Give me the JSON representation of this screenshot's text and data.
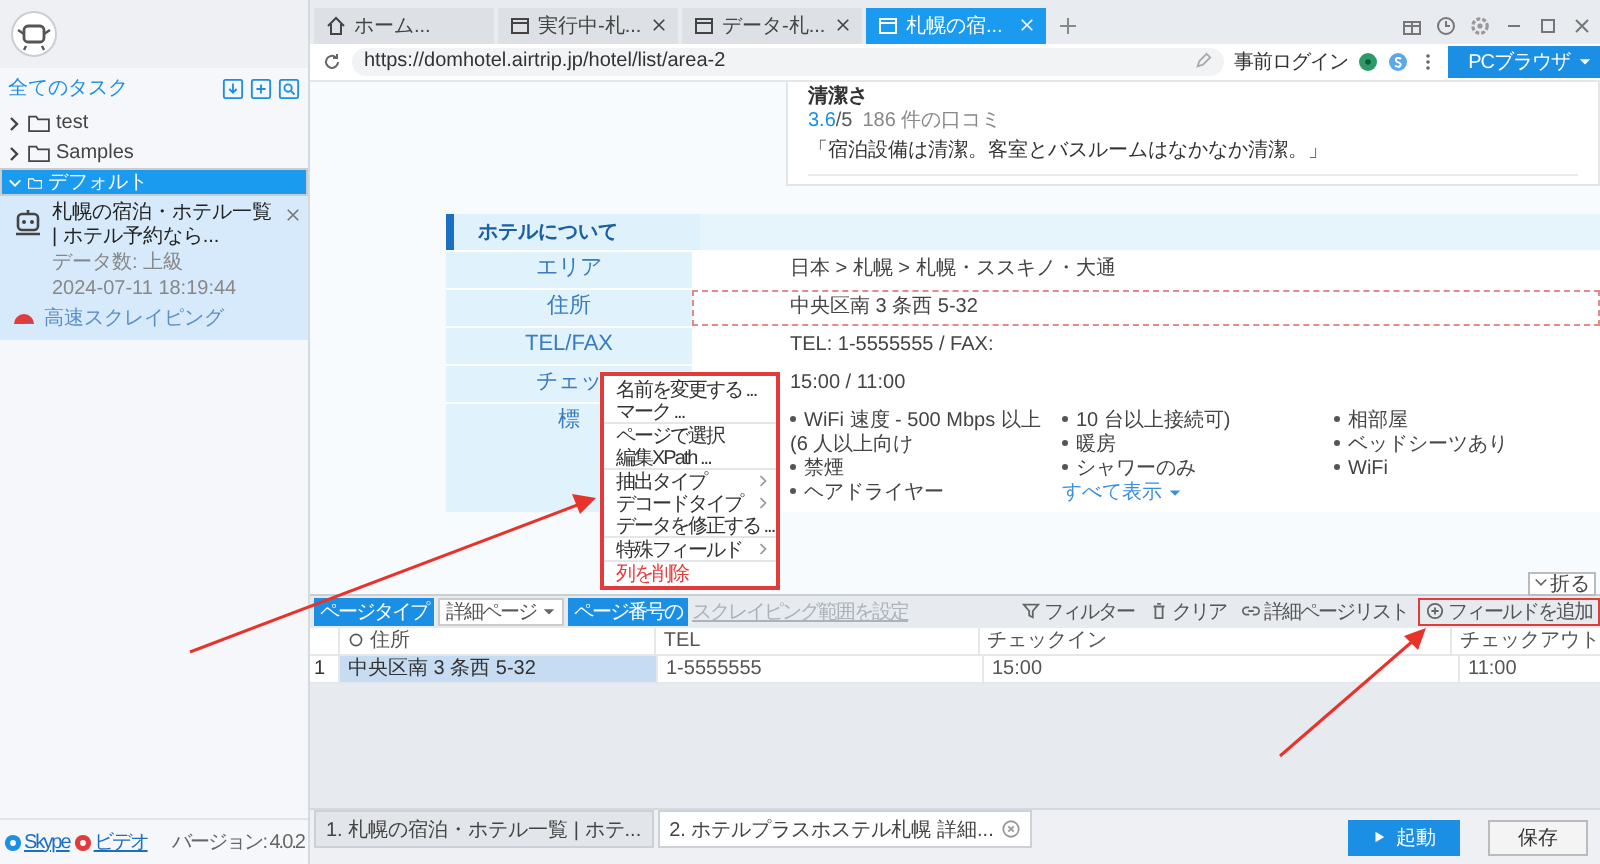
{
  "sidebar": {
    "title": "全てのタスク",
    "tree": [
      {
        "label": "test",
        "expanded": false,
        "selected": false
      },
      {
        "label": "Samples",
        "expanded": false,
        "selected": false
      },
      {
        "label": "デフォルト",
        "expanded": true,
        "selected": true,
        "tasks": [
          {
            "title": "札幌の宿泊・ホテル一覧 | ホテル予約なら...",
            "data_count": "データ数: 上級",
            "time": "2024-07-11 18:19:44",
            "mode": "高速スクレイピング"
          }
        ]
      }
    ],
    "footer": {
      "links": [
        "Skype",
        "ビデオ"
      ],
      "version": "バージョン: 4.0.2"
    }
  },
  "browser": {
    "tabs": [
      {
        "label": "ホーム...",
        "kind": "home",
        "selected": false
      },
      {
        "label": "実行中-札...",
        "kind": "page",
        "selected": false
      },
      {
        "label": "データ-札...",
        "kind": "page",
        "selected": false
      },
      {
        "label": "札幌の宿...",
        "kind": "page",
        "selected": true
      }
    ],
    "url": "https://domhotel.airtrip.jp/hotel/list/area-2",
    "login": "事前ログイン",
    "mode_button": "PCブラウザ"
  },
  "page": {
    "review": {
      "title": "清潔さ",
      "score": "3.6",
      "scale": "/5",
      "count": "186 件の口コミ",
      "quote": "「宿泊設備は清潔。客室とバスルームはなかなか清潔。」"
    },
    "section_title": "ホテルについて",
    "rows": [
      {
        "kind": "text",
        "label": "エリア",
        "value": "日本 > 札幌 > 札幌・ススキノ・大通",
        "highlighted": false
      },
      {
        "kind": "text",
        "label": "住所",
        "value": "中央区南 3 条西 5-32",
        "highlighted": true
      },
      {
        "kind": "text",
        "label": "TEL/FAX",
        "value": "TEL: 1-5555555 / FAX:",
        "highlighted": false
      },
      {
        "kind": "text",
        "label": "チェッ",
        "value": "15:00 / 11:00",
        "highlighted": false
      },
      {
        "kind": "list",
        "label": "標",
        "highlighted": false,
        "more": "すべて表示",
        "columns": [
          [
            "WiFi 速度 - 500 Mbps 以上 (6 人以上向け",
            "禁煙",
            "ヘアドライヤー"
          ],
          [
            "10 台以上接続可)",
            "暖房",
            "シャワーのみ"
          ],
          [
            "相部屋",
            "ベッドシーツあり",
            "WiFi"
          ]
        ]
      }
    ]
  },
  "context_menu": {
    "groups": [
      [
        {
          "label": "名前を変更する ...",
          "submenu": false,
          "danger": false
        },
        {
          "label": "マーク ...",
          "submenu": false,
          "danger": false
        }
      ],
      [
        {
          "label": "ページで選択",
          "submenu": false,
          "danger": false
        },
        {
          "label": "編集XPath ...",
          "submenu": false,
          "danger": false
        }
      ],
      [
        {
          "label": "抽出タイプ",
          "submenu": true,
          "danger": false
        },
        {
          "label": "デコードタイプ",
          "submenu": true,
          "danger": false
        },
        {
          "label": "データを修正する ...",
          "submenu": false,
          "danger": false
        }
      ],
      [
        {
          "label": "特殊フィールド",
          "submenu": true,
          "danger": false
        }
      ],
      [
        {
          "label": "列を削除",
          "submenu": false,
          "danger": true
        }
      ]
    ]
  },
  "panel": {
    "fold": "折る",
    "toolbar": {
      "page_type_label": "ページタイプ",
      "page_type": "詳細ページ",
      "pager_label": "ページ番号の",
      "range": {
        "label": "スクレイピング範囲を設定",
        "disabled": true
      },
      "actions": [
        {
          "label": "フィルター",
          "kind": "filter",
          "highlighted": false
        },
        {
          "label": "クリア",
          "kind": "clear",
          "highlighted": false
        },
        {
          "label": "詳細ページリスト",
          "kind": "link",
          "highlighted": false
        },
        {
          "label": "フィールドを追加",
          "kind": "add",
          "highlighted": true
        }
      ]
    },
    "table": {
      "columns": [
        {
          "label": "住所",
          "selected": true
        },
        {
          "label": "TEL",
          "selected": false
        },
        {
          "label": "チェックイン",
          "selected": false
        },
        {
          "label": "チェックアウト",
          "selected": false
        }
      ],
      "rows": [
        {
          "number": "1",
          "cells": [
            "中央区南 3 条西 5-32",
            "1-5555555",
            "15:00",
            "11:00"
          ]
        }
      ]
    }
  },
  "bottom": {
    "tabs": [
      {
        "label": "1. 札幌の宿泊・ホテル一覧 | ホテ...",
        "selected": false,
        "closable": false
      },
      {
        "label": "2. ホテルプラスホステル札幌 詳細...",
        "selected": true,
        "closable": true
      }
    ],
    "start": "起動",
    "save": "保存"
  }
}
